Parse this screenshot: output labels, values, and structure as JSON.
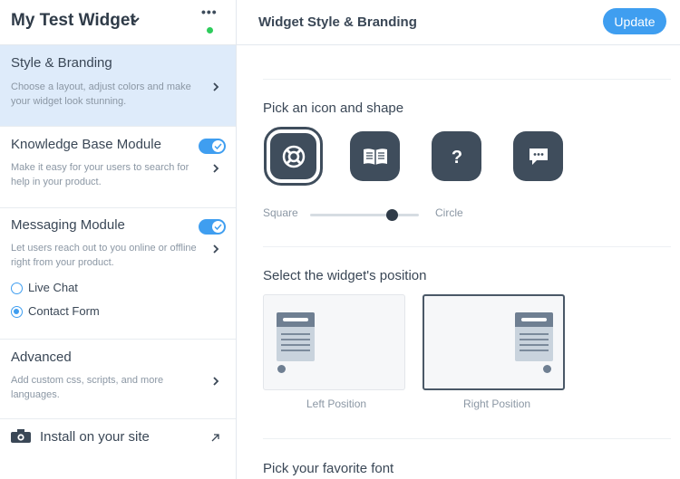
{
  "sidebar": {
    "widget_name": "My Test Widget",
    "sections": [
      {
        "title": "Style & Branding",
        "desc": "Choose a layout, adjust colors and make your widget look stunning."
      },
      {
        "title": "Knowledge Base Module",
        "desc": "Make it easy for your users to search for help in your product.",
        "enabled": true
      },
      {
        "title": "Messaging Module",
        "desc": "Let users reach out to you online or offline right from your product.",
        "enabled": true
      },
      {
        "title": "Advanced",
        "desc": "Add custom css, scripts, and more languages."
      }
    ],
    "messaging_options": [
      {
        "label": "Live Chat",
        "checked": false
      },
      {
        "label": "Contact Form",
        "checked": true
      }
    ],
    "install_label": "Install on your site"
  },
  "main": {
    "title": "Widget Style & Branding",
    "update_label": "Update",
    "icon_shape": {
      "heading": "Pick an icon and shape",
      "icons": [
        "lifebuoy-icon",
        "book-icon",
        "question-icon",
        "chat-bubble-icon"
      ],
      "selected_icon": "lifebuoy-icon",
      "shape_min_label": "Square",
      "shape_max_label": "Circle",
      "shape_value": 0.75
    },
    "position": {
      "heading": "Select the widget's position",
      "options": [
        "Left Position",
        "Right Position"
      ],
      "selected": "Right Position"
    },
    "font": {
      "heading": "Pick your favorite font"
    }
  },
  "colors": {
    "accent": "#3f9ef0",
    "active_section_bg": "#deebfa",
    "icon_tile": "#3f4d5c",
    "status_online": "#2ecc5c"
  }
}
